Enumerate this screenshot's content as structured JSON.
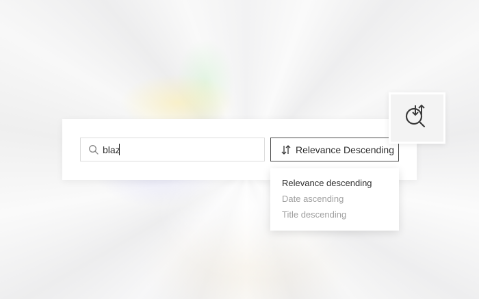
{
  "search": {
    "value": "blaz",
    "icon": "search-icon"
  },
  "sort": {
    "selected_label": "Relevance Descending",
    "icon": "sort-arrows-icon",
    "options": [
      {
        "label": "Relevance descending",
        "selected": true
      },
      {
        "label": "Date ascending",
        "selected": false
      },
      {
        "label": "Title descending",
        "selected": false
      }
    ]
  },
  "feature_icon": "search-sort-icon",
  "colors": {
    "text": "#2d2d2d",
    "muted_text": "#a0a0a0",
    "border": "#dcdcdc",
    "button_border": "#4a4a4a"
  }
}
